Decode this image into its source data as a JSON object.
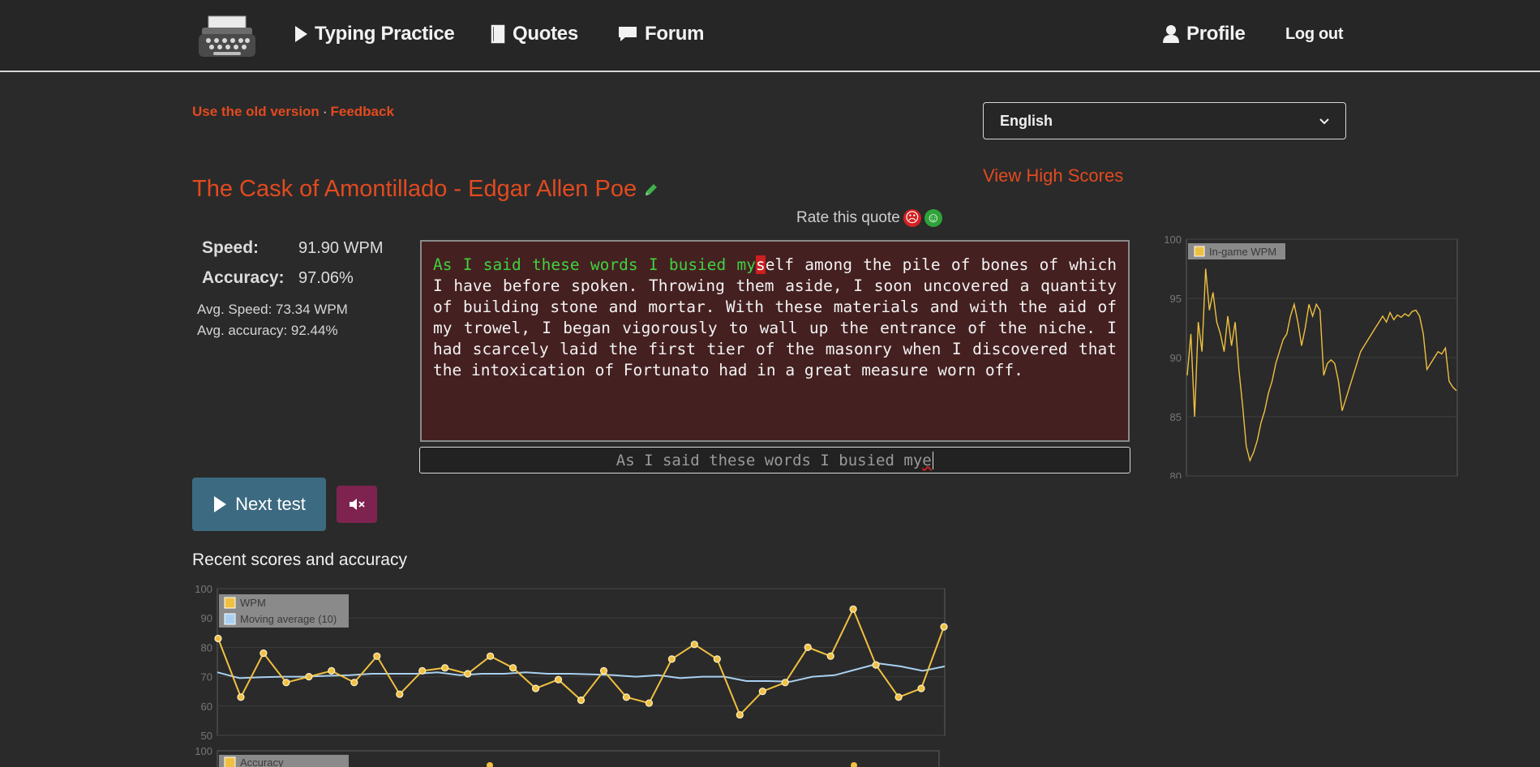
{
  "nav": {
    "items": [
      {
        "label": "Typing Practice",
        "icon": "play-icon"
      },
      {
        "label": "Quotes",
        "icon": "book-icon"
      },
      {
        "label": "Forum",
        "icon": "speech-bubble-icon"
      }
    ],
    "profile_label": "Profile",
    "logout_label": "Log out"
  },
  "links": {
    "old_version": "Use the old version",
    "separator": "·",
    "feedback": "Feedback"
  },
  "language_select": {
    "selected": "English"
  },
  "high_scores_label": "View High Scores",
  "quote_title": "The Cask of Amontillado - Edgar Allen Poe",
  "rate_label": "Rate this quote",
  "stats": {
    "speed_label": "Speed:",
    "speed_value": "91.90 WPM",
    "accuracy_label": "Accuracy:",
    "accuracy_value": "97.06%",
    "avg_speed": "Avg. Speed: 73.34 WPM",
    "avg_accuracy": "Avg. accuracy: 92.44%"
  },
  "quote": {
    "typed_correct": "As I said these words I busied my",
    "error_char": "s",
    "remaining": "elf among the pile of bones of which I have before spoken. Throwing them aside, I soon uncovered a quantity of building stone and mortar. With these materials and with the aid of my trowel, I began vigorously to wall up the entrance of the niche. I had scarcely laid the first tier of the masonry when I discovered that the intoxication of Fortunato had in a great measure worn off."
  },
  "input": {
    "value_ok": "As I said these words I busied my",
    "value_err": "e"
  },
  "buttons": {
    "next_test": "Next test"
  },
  "recent_title": "Recent scores and accuracy",
  "colors": {
    "accent": "#e24a1f",
    "wpm_line": "#f0c040",
    "moving_avg_line": "#a9d0f0",
    "quote_bg": "#452021",
    "correct_text": "#3fd23f",
    "next_button": "#3c6a80",
    "mute_button": "#7e2350"
  },
  "chart_data": [
    {
      "type": "line",
      "legend": [
        "In-game WPM"
      ],
      "yticks": [
        80,
        85,
        90,
        95,
        100
      ],
      "ylim": [
        80,
        100
      ],
      "series": [
        {
          "name": "In-game WPM",
          "values": [
            88.5,
            92.0,
            85.0,
            93.0,
            90.5,
            97.5,
            94.0,
            95.5,
            93.0,
            92.0,
            90.5,
            93.5,
            91.0,
            93.0,
            89.0,
            86.0,
            82.5,
            81.3,
            82.0,
            83.0,
            84.5,
            85.5,
            87.0,
            88.0,
            89.5,
            90.5,
            91.5,
            92.0,
            93.5,
            94.5,
            93.0,
            91.0,
            92.5,
            94.5,
            93.5,
            94.5,
            94.0,
            88.5,
            89.5,
            89.8,
            89.5,
            88.0,
            85.5,
            86.5,
            87.5,
            88.5,
            89.5,
            90.5,
            91.0,
            91.5,
            92.0,
            92.5,
            93.0,
            93.5,
            93.0,
            93.8,
            93.2,
            93.6,
            93.4,
            93.7,
            93.5,
            93.9,
            94.0,
            93.5,
            92.0,
            89.0,
            89.5,
            90.0,
            90.5,
            90.3,
            90.8,
            88.0,
            87.5,
            87.2
          ]
        }
      ]
    },
    {
      "type": "line",
      "legend": [
        "WPM",
        "Moving average (10)"
      ],
      "yticks": [
        50,
        60,
        70,
        80,
        90,
        100
      ],
      "ylim": [
        50,
        100
      ],
      "series": [
        {
          "name": "WPM",
          "values": [
            83,
            63,
            78,
            68,
            70,
            72,
            68,
            77,
            64,
            72,
            73,
            71,
            77,
            73,
            66,
            69,
            62,
            72,
            63,
            61,
            76,
            81,
            76,
            57,
            65,
            68,
            80,
            77,
            93,
            74,
            63,
            66,
            87
          ]
        },
        {
          "name": "Moving average (10)",
          "values": [
            71.5,
            69.5,
            69.8,
            70.0,
            70.0,
            70.3,
            70.5,
            71.0,
            71.0,
            71.0,
            71.5,
            70.5,
            71.0,
            71.0,
            71.5,
            71.0,
            71.0,
            70.8,
            70.5,
            70.0,
            70.5,
            69.5,
            70.0,
            70.0,
            68.5,
            68.5,
            68.3,
            70.0,
            70.5,
            72.5,
            74.5,
            73.5,
            72.0,
            73.5
          ]
        }
      ]
    },
    {
      "type": "line",
      "legend": [
        "Accuracy"
      ],
      "yticks": [
        100
      ],
      "ylim": [
        50,
        100
      ]
    }
  ]
}
